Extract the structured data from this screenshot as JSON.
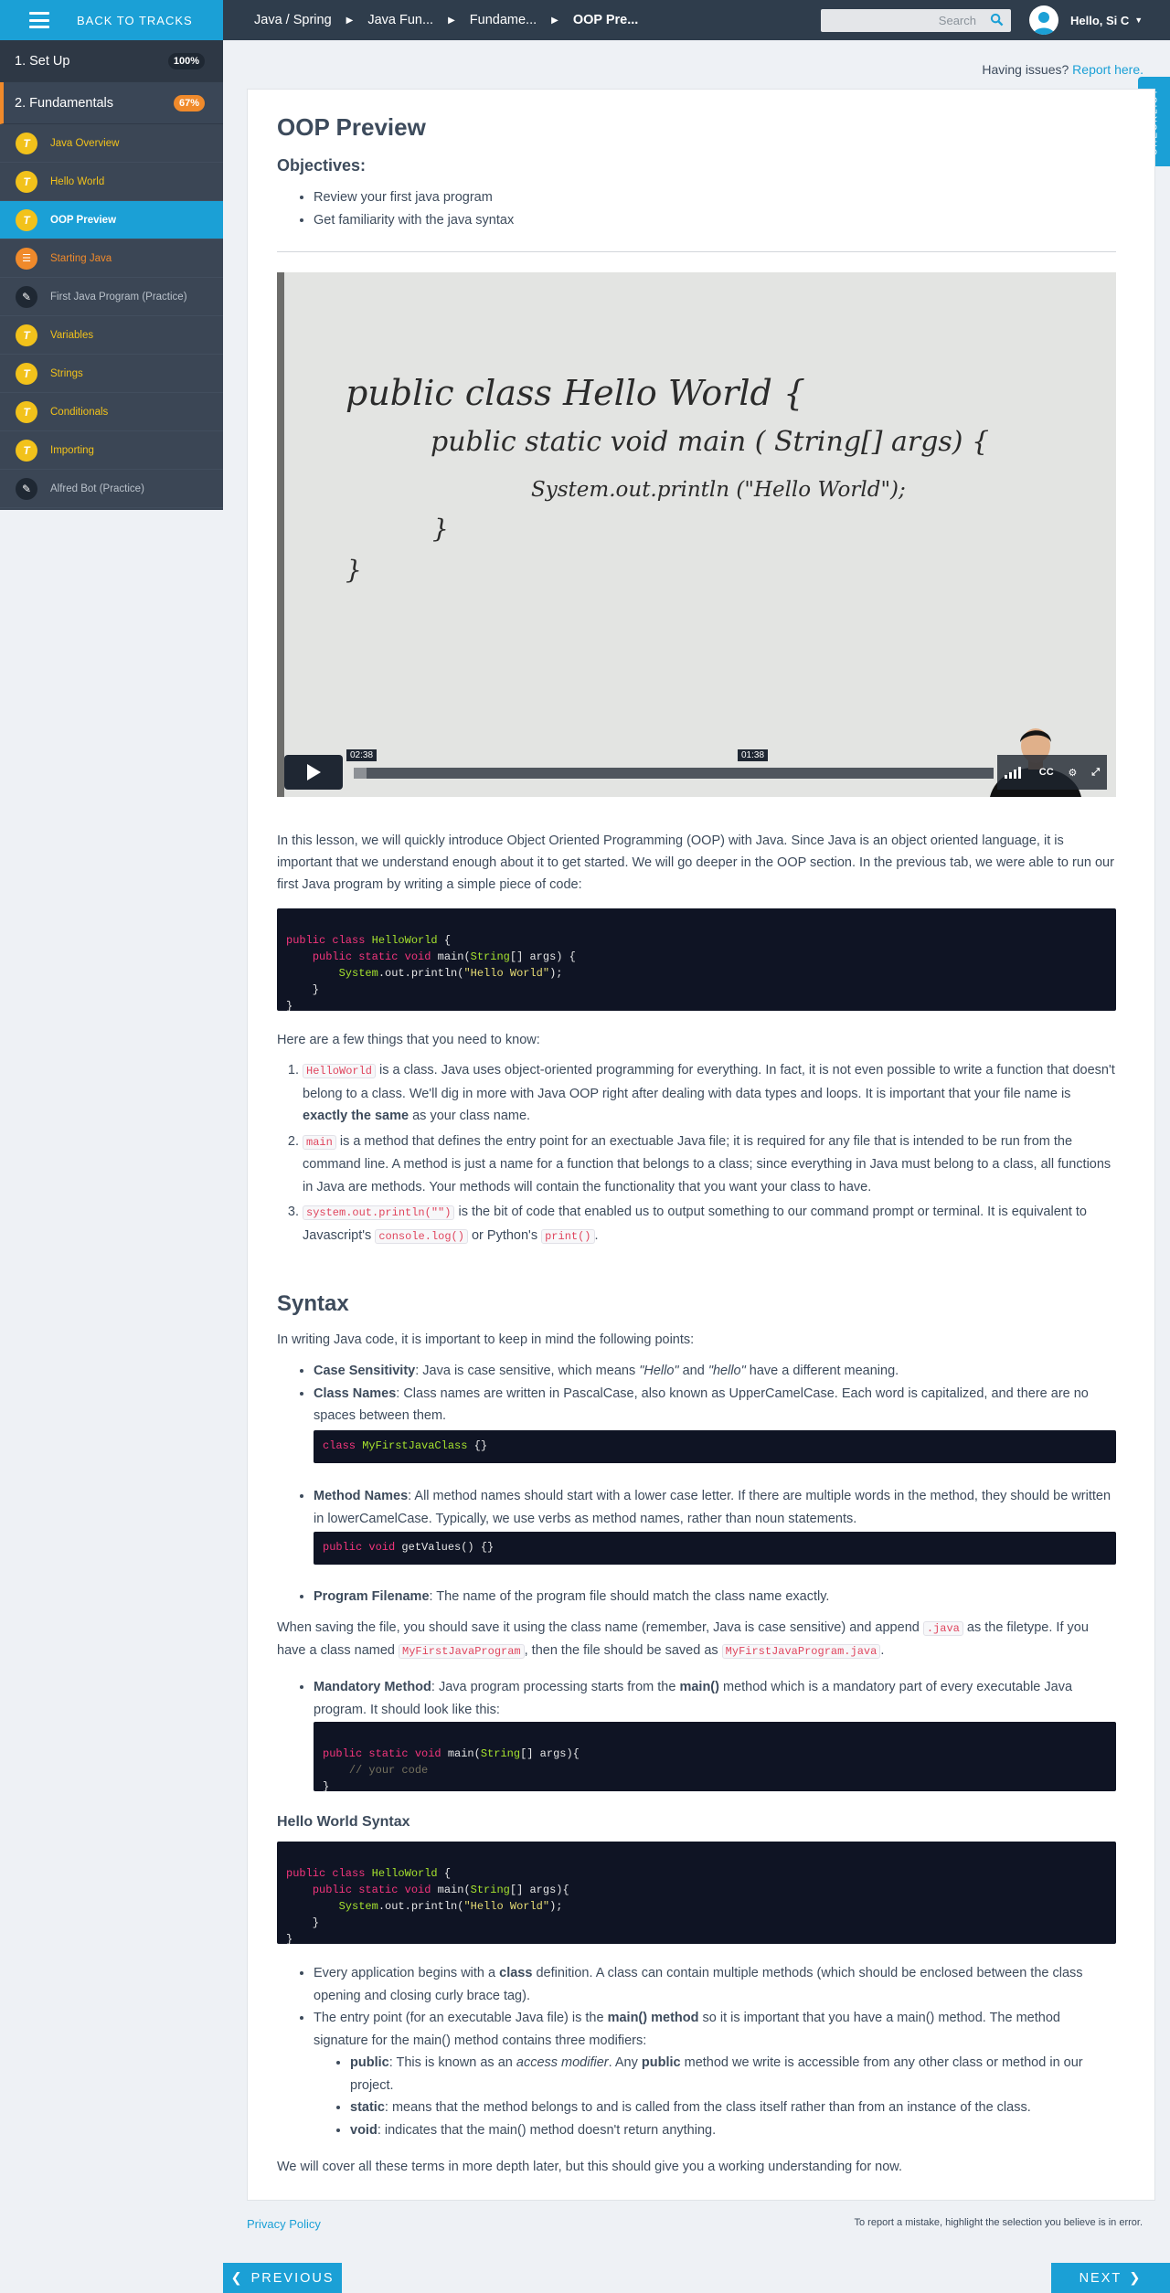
{
  "topbar": {
    "back_label": "BACK TO TRACKS",
    "breadcrumbs": [
      "Java / Spring",
      "Java Fun...",
      "Fundame...",
      "OOP Pre..."
    ],
    "search_placeholder": "Search",
    "user_greeting": "Hello, Si C"
  },
  "sidebar": {
    "sections": [
      {
        "label": "1. Set Up",
        "progress": "100%"
      },
      {
        "label": "2. Fundamentals",
        "progress": "67%"
      }
    ],
    "items": [
      {
        "label": "Java Overview",
        "icon": "video-icon"
      },
      {
        "label": "Hello World",
        "icon": "video-icon"
      },
      {
        "label": "OOP Preview",
        "icon": "video-icon"
      },
      {
        "label": "Starting Java",
        "icon": "quiz-icon"
      },
      {
        "label": "First Java Program (Practice)",
        "icon": "pencil-icon"
      },
      {
        "label": "Variables",
        "icon": "video-icon"
      },
      {
        "label": "Strings",
        "icon": "video-icon"
      },
      {
        "label": "Conditionals",
        "icon": "video-icon"
      },
      {
        "label": "Importing",
        "icon": "video-icon"
      },
      {
        "label": "Alfred Bot (Practice)",
        "icon": "pencil-icon"
      }
    ]
  },
  "issues": {
    "prefix": "Having issues?",
    "link": "Report here."
  },
  "checklist_label": "CHECKLIST",
  "lesson": {
    "title": "OOP Preview",
    "objectives_heading": "Objectives:",
    "objectives": [
      "Review your first java program",
      "Get familiarity with the java syntax"
    ],
    "video": {
      "time_played": "02:38",
      "time_hover": "01:38",
      "played_fraction": 0.02,
      "cc_label": "CC"
    },
    "intro": "In this lesson, we will quickly introduce Object Oriented Programming (OOP) with Java. Since Java is an object oriented language, it is important that we understand enough about it to get started. We will go deeper in the OOP section. In the previous tab, we were able to run our first Java program by writing a simple piece of code:",
    "know_intro": "Here are a few things that you need to know:",
    "point1_code": "HelloWorld",
    "point1_a": " is a class. Java uses object-oriented programming for everything. In fact, it is not even possible to write a function that doesn't belong to a class. We'll dig in more with Java OOP right after dealing with data types and loops. It is important that your file name is ",
    "point1_b": "exactly the same",
    "point1_c": " as your class name.",
    "point2_code": "main",
    "point2_text": " is a method that defines the entry point for an exectuable Java file; it is required for any file that is intended to be run from the command line. A method is just a name for a function that belongs to a class; since everything in Java must belong to a class, all functions in Java are methods. Your methods will contain the functionality that you want your class to have.",
    "point3_code": "system.out.println(\"\")",
    "point3_a": " is the bit of code that enabled us to output something to our command prompt or terminal. It is equivalent to Javascript's ",
    "point3_code2": "console.log()",
    "point3_b": " or Python's ",
    "point3_code3": "print()",
    "point3_c": ".",
    "syntax_heading": "Syntax",
    "syntax_intro": "In writing Java code, it is important to keep in mind the following points:",
    "case_label": "Case Sensitivity",
    "case_a": ": Java is case sensitive, which means ",
    "case_hello1": "\"Hello\"",
    "case_and": " and ",
    "case_hello2": "\"hello\"",
    "case_b": " have a different meaning.",
    "classnames_label": "Class Names",
    "classnames_text": ": Class names are written in PascalCase, also known as UpperCamelCase. Each word is capitalized, and there are no spaces between them.",
    "method_label": "Method Names",
    "method_text": ": All method names should start with a lower case letter. If there are multiple words in the method, they should be written in lowerCamelCase. Typically, we use verbs as method names, rather than noun statements.",
    "filename_label": "Program Filename",
    "filename_text": ": The name of the program file should match the class name exactly.",
    "saving_a": "When saving the file, you should save it using the class name (remember, Java is case sensitive) and append ",
    "saving_code1": ".java",
    "saving_b": " as the filetype. If you have a class named ",
    "saving_code2": "MyFirstJavaProgram",
    "saving_c": ", then the file should be saved as ",
    "saving_code3": "MyFirstJavaProgram.java",
    "saving_d": ".",
    "mandatory_label": "Mandatory Method",
    "mandatory_a": ": Java program processing starts from the ",
    "mandatory_b": "main()",
    "mandatory_c": " method which is a mandatory part of every executable Java program. It should look like this:",
    "hws_heading": "Hello World Syntax",
    "app_a": "Every application begins with a ",
    "app_b": "class",
    "app_c": " definition. A class can contain multiple methods (which should be enclosed between the class opening and closing curly brace tag).",
    "entry_a": "The entry point (for an executable Java file) is the ",
    "entry_b": "main() method",
    "entry_c": " so it is important that you have a main() method. The method signature for the main() method contains three modifiers:",
    "mod_public_label": "public",
    "mod_public_a": ": This is known as an ",
    "mod_public_em": "access modifier",
    "mod_public_b": ". Any ",
    "mod_public_c": "public",
    "mod_public_d": " method we write is accessible from any other class or method in our project.",
    "mod_static_label": "static",
    "mod_static_text": ":  means that the method belongs to and is called from the class itself rather than from an instance of the class.",
    "mod_void_label": "void",
    "mod_void_text": ": indicates that the main() method doesn't return anything.",
    "closing": "We will cover all these terms in more depth later, but this should give you a working understanding for now."
  },
  "code": {
    "hello1": [
      "public class HelloWorld {",
      "    public static void main(String[] args) {",
      "        System.out.println(\"Hello World\");",
      "    }",
      "}"
    ],
    "classname": "class MyFirstJavaClass {}",
    "method": "public void getValues() {}",
    "mainmethod": [
      "public static void main(String[] args){",
      "    // your code",
      "}"
    ],
    "hello2": [
      "public class HelloWorld {",
      "    public static void main(String[] args){",
      "        System.out.println(\"Hello World\");",
      "    }",
      "}"
    ]
  },
  "whiteboard": [
    "public class Hello World {",
    "public static void main ( String[] args) {",
    "System.out.println (\"Hello World\");",
    "}",
    "}"
  ],
  "footer": {
    "privacy": "Privacy Policy",
    "report_note": "To report a mistake, highlight the selection you believe is in error.",
    "previous": "PREVIOUS",
    "next": "NEXT"
  },
  "colors": {
    "accent": "#1ba0d6",
    "progress_orange": "#f08a2b",
    "lesson_yellow": "#f2c21b",
    "topbar": "#2f3d4c",
    "code_bg": "#0f1424"
  }
}
